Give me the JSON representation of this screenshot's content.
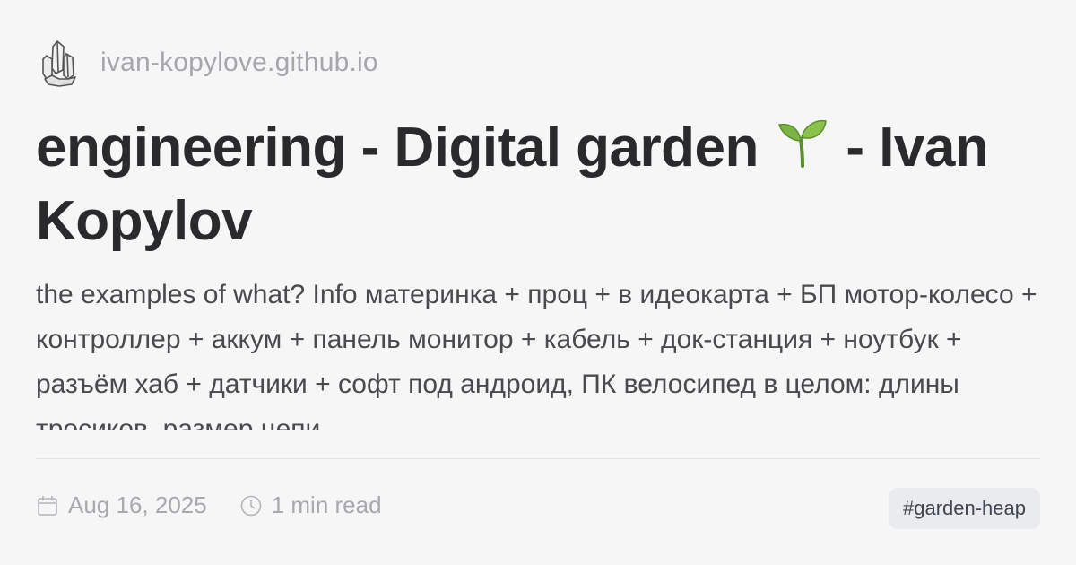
{
  "site": {
    "url": "ivan-kopylove.github.io",
    "logo_icon": "crystal-cluster-icon"
  },
  "post": {
    "title_before_emoji": "engineering - Digital garden ",
    "title_emoji_icon": "seedling-icon",
    "title_after_emoji": " - Ivan Kopylov",
    "description": "the examples of what? Info материнка + проц + в идеокарта + БП мотор-колесо + контроллер + аккум + панель монитор + кабель + док-станция + ноутбук + разъём хаб + датчики + софт под андроид, ПК велосипед в целом: длины тросиков, размер цепи"
  },
  "meta": {
    "date": "Aug 16, 2025",
    "date_icon": "calendar-icon",
    "read_time": "1 min read",
    "read_time_icon": "clock-icon",
    "tag": "#garden-heap"
  },
  "colors": {
    "background": "#f6f6f7",
    "title": "#2a2a2d",
    "muted": "#a8a8ae",
    "tag_bg": "#e9ebee"
  }
}
